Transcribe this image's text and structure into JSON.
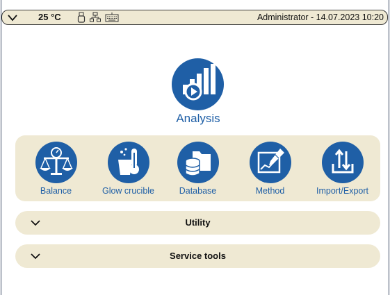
{
  "statusbar": {
    "temperature": "25 °C",
    "user_datetime": "Administrator - 14.07.2023 10:20",
    "icons": [
      "chevron-down-icon",
      "usb-stick-icon",
      "network-icon",
      "keyboard-icon"
    ]
  },
  "hero": {
    "label": "Analysis",
    "icon": "analysis-bar-chart-play-icon"
  },
  "tiles": [
    {
      "label": "Balance",
      "icon": "balance-scale-icon"
    },
    {
      "label": "Glow crucible",
      "icon": "glow-crucible-thermometer-icon"
    },
    {
      "label": "Database",
      "icon": "database-folder-icon"
    },
    {
      "label": "Method",
      "icon": "method-edit-chart-icon"
    },
    {
      "label": "Import/Export",
      "icon": "import-export-icon"
    }
  ],
  "sections": [
    {
      "label": "Utility"
    },
    {
      "label": "Service tools"
    }
  ],
  "colors": {
    "accent": "#1f5fa6",
    "panel": "#efe9d3",
    "text": "#111111"
  }
}
